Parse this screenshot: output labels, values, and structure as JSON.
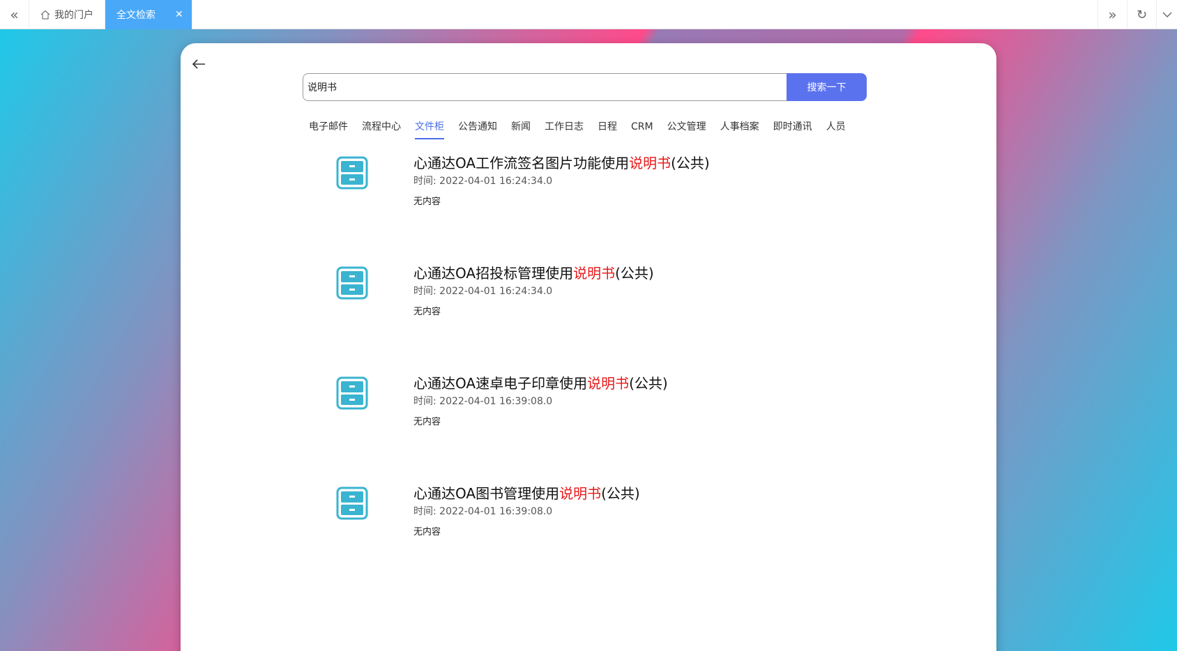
{
  "tabbar": {
    "tabs": [
      {
        "label": "我的门户",
        "active": false
      },
      {
        "label": "全文检索",
        "active": true
      }
    ]
  },
  "search": {
    "value": "说明书",
    "button_label": "搜索一下"
  },
  "categories": [
    "电子邮件",
    "流程中心",
    "文件柜",
    "公告通知",
    "新闻",
    "工作日志",
    "日程",
    "CRM",
    "公文管理",
    "人事档案",
    "即时通讯",
    "人员"
  ],
  "active_category": "文件柜",
  "results": [
    {
      "title_pre": "心通达OA工作流签名图片功能使用",
      "highlight": "说明书",
      "title_post": "(公共)",
      "time": "时间: 2022-04-01 16:24:34.0",
      "desc": "无内容"
    },
    {
      "title_pre": "心通达OA招投标管理使用",
      "highlight": "说明书",
      "title_post": "(公共)",
      "time": "时间: 2022-04-01 16:24:34.0",
      "desc": "无内容"
    },
    {
      "title_pre": "心通达OA速卓电子印章使用",
      "highlight": "说明书",
      "title_post": "(公共)",
      "time": "时间: 2022-04-01 16:39:08.0",
      "desc": "无内容"
    },
    {
      "title_pre": "心通达OA图书管理使用",
      "highlight": "说明书",
      "title_post": "(公共)",
      "time": "时间: 2022-04-01 16:39:08.0",
      "desc": "无内容"
    }
  ],
  "colors": {
    "accent": "#5b72ee",
    "active_tab": "#4aa8f8",
    "highlight": "#e8181a",
    "icon": "#3ab4d0"
  }
}
